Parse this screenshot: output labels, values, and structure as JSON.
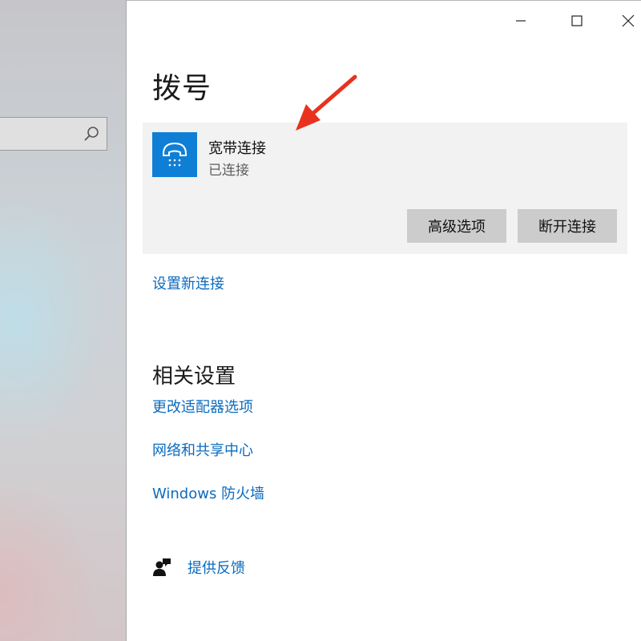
{
  "window": {
    "controls": {
      "minimize_icon": "minimize-icon",
      "maximize_icon": "maximize-icon",
      "close_icon": "close-icon"
    }
  },
  "left_pane": {
    "search_icon": "search-icon"
  },
  "page": {
    "title": "拨号"
  },
  "connection": {
    "icon": "phone-icon",
    "icon_bg": "#0f7fd6",
    "name": "宽带连接",
    "status": "已连接",
    "advanced_label": "高级选项",
    "disconnect_label": "断开连接"
  },
  "setup_link": "设置新连接",
  "related": {
    "title": "相关设置",
    "links": [
      "更改适配器选项",
      "网络和共享中心",
      "Windows 防火墙"
    ]
  },
  "feedback": {
    "icon": "feedback-person-icon",
    "label": "提供反馈"
  },
  "colors": {
    "accent_link": "#0b6bbf",
    "annotation_arrow": "#e8321e"
  }
}
